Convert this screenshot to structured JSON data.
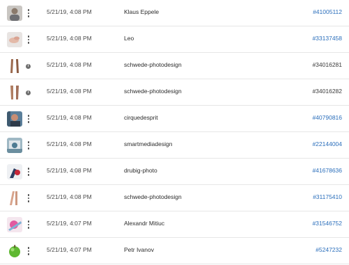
{
  "colors": {
    "link": "#2a6ebb",
    "text": "#2c2c2c",
    "muted": "#4b4b4b",
    "divider": "#e6e6e6"
  },
  "rows": [
    {
      "thumb": "portrait-man-thumbnail",
      "menu": "more-options-icon",
      "date": "5/21/19, 4:08 PM",
      "author": "Klaus Eppele",
      "asset_id": "#41005112",
      "id_is_link": true
    },
    {
      "thumb": "hands-thumbnail",
      "menu": "more-options-icon",
      "date": "5/21/19, 4:08 PM",
      "author": "Leo",
      "asset_id": "#33137458",
      "id_is_link": true
    },
    {
      "thumb": "legs-thumbnail",
      "menu": "info-icon",
      "date": "5/21/19, 4:08 PM",
      "author": "schwede-photodesign",
      "asset_id": "#34016281",
      "id_is_link": false
    },
    {
      "thumb": "legs-thumbnail",
      "menu": "info-icon",
      "date": "5/21/19, 4:08 PM",
      "author": "schwede-photodesign",
      "asset_id": "#34016282",
      "id_is_link": false
    },
    {
      "thumb": "portrait-thumbnail",
      "menu": "more-options-icon",
      "date": "5/21/19, 4:08 PM",
      "author": "cirquedesprit",
      "asset_id": "#40790816",
      "id_is_link": true
    },
    {
      "thumb": "medical-thumbnail",
      "menu": "more-options-icon",
      "date": "5/21/19, 4:08 PM",
      "author": "smartmediadesign",
      "asset_id": "#22144004",
      "id_is_link": true
    },
    {
      "thumb": "sport-thumbnail",
      "menu": "more-options-icon",
      "date": "5/21/19, 4:08 PM",
      "author": "drubig-photo",
      "asset_id": "#41678636",
      "id_is_link": true
    },
    {
      "thumb": "legs-thumbnail",
      "menu": "more-options-icon",
      "date": "5/21/19, 4:08 PM",
      "author": "schwede-photodesign",
      "asset_id": "#31175410",
      "id_is_link": true
    },
    {
      "thumb": "pink-object-thumbnail",
      "menu": "more-options-icon",
      "date": "5/21/19, 4:07 PM",
      "author": "Alexandr Mitiuc",
      "asset_id": "#31546752",
      "id_is_link": true
    },
    {
      "thumb": "apple-thumbnail",
      "menu": "more-options-icon",
      "date": "5/21/19, 4:07 PM",
      "author": "Petr Ivanov",
      "asset_id": "#5247232",
      "id_is_link": true
    }
  ]
}
